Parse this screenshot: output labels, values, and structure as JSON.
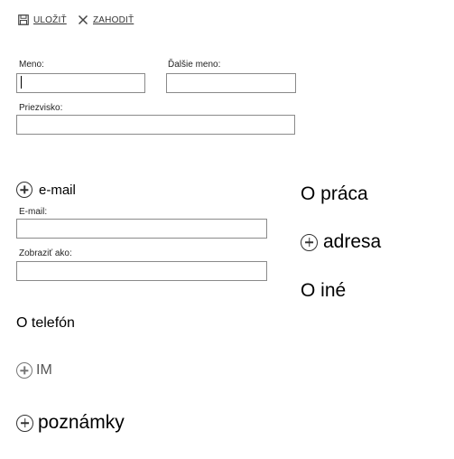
{
  "toolbar": {
    "save_label": "ULOŽIŤ",
    "save_icon": "floppy-disk-icon",
    "discard_label": "ZAHODIŤ",
    "discard_icon": "close-x-icon"
  },
  "name_form": {
    "first_name_label": "Meno:",
    "first_name_value": "",
    "middle_name_label": "Ďalšie meno:",
    "middle_name_value": "",
    "last_name_label": "Priezvisko:",
    "last_name_value": ""
  },
  "email_section": {
    "header": "e-mail",
    "icon": "plus-circle-icon",
    "email_label": "E-mail:",
    "email_value": "",
    "display_as_label": "Zobraziť ako:",
    "display_as_value": ""
  },
  "sections": {
    "work": "O práca",
    "address": "adresa",
    "address_icon": "plus-circle-icon",
    "other": "O iné",
    "phone": "O telefón",
    "im": "IM",
    "im_icon": "plus-circle-icon",
    "notes": "poznámky",
    "notes_icon": "plus-circle-icon"
  },
  "colors": {
    "text": "#000000",
    "muted": "#555555",
    "field_border": "#8a8a8a",
    "background": "#ffffff"
  }
}
